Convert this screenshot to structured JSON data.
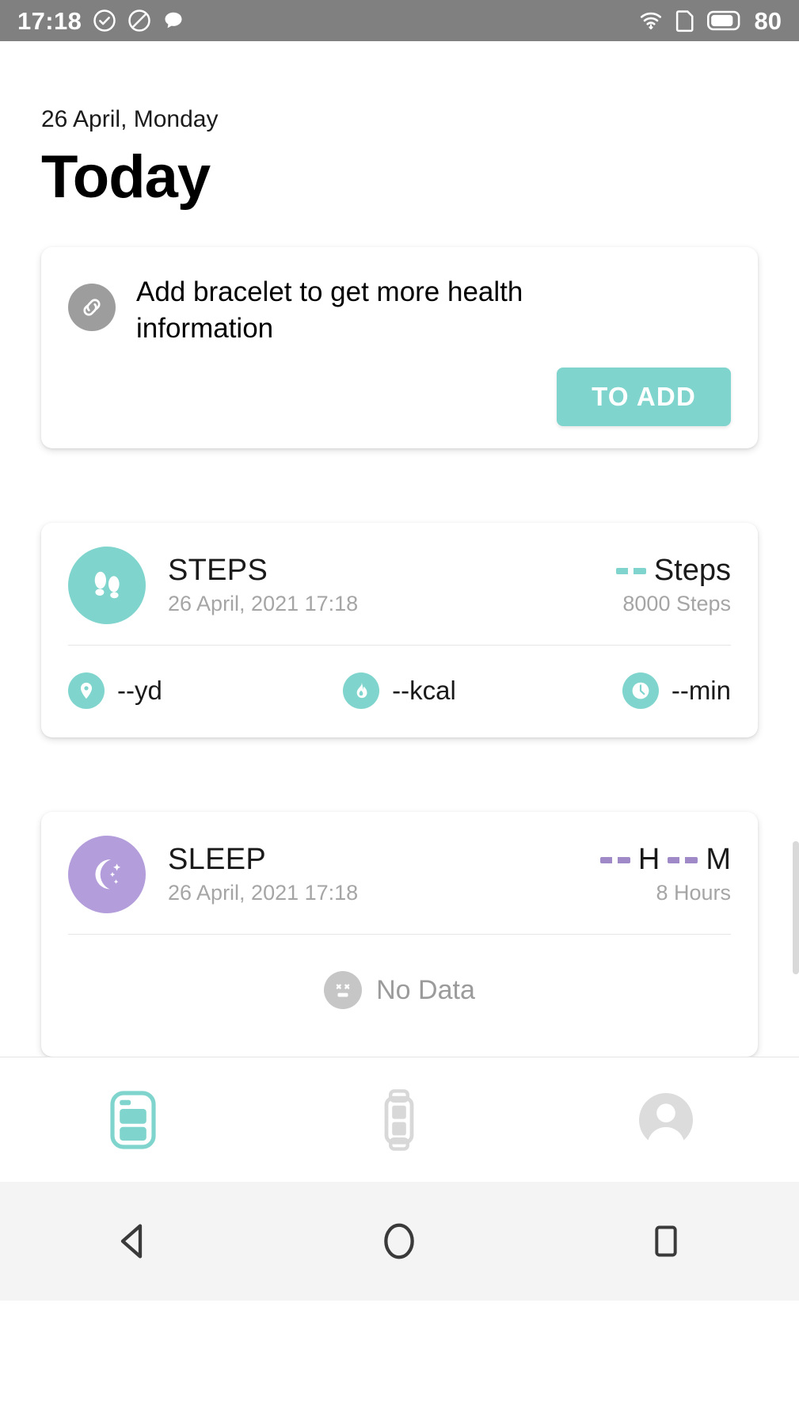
{
  "status_bar": {
    "time": "17:18",
    "battery_level": "80",
    "left_icons": [
      "check-circle-icon",
      "do-not-disturb-icon",
      "message-bubble-icon"
    ],
    "right_icons": [
      "wifi-icon",
      "sim-card-icon",
      "battery-icon"
    ],
    "background_color": "#808080"
  },
  "header": {
    "date": "26 April, Monday",
    "title": "Today"
  },
  "banner": {
    "icon": "link-icon",
    "message": "Add bracelet to get more health information",
    "button_label": "TO ADD",
    "button_color": "#7fd5cd"
  },
  "cards": [
    {
      "id": "steps",
      "icon": "footprints-icon",
      "accent_color": "#7fd5cd",
      "name": "STEPS",
      "timestamp": "26 April, 2021 17:18",
      "legend_label": "Steps",
      "legend_value": "8000 Steps",
      "stats": [
        {
          "icon": "location-pin-icon",
          "value": "--yd"
        },
        {
          "icon": "flame-icon",
          "value": "--kcal"
        },
        {
          "icon": "clock-icon",
          "value": "--min"
        }
      ]
    },
    {
      "id": "sleep",
      "icon": "moon-stars-icon",
      "accent_color": "#b39ddb",
      "name": "SLEEP",
      "timestamp": "26 April, 2021 17:18",
      "legend_hours": "H",
      "legend_minutes": "M",
      "legend_value": "8 Hours",
      "empty_state": {
        "icon": "dizzy-face-icon",
        "text": "No Data"
      }
    }
  ],
  "bottom_nav": {
    "items": [
      {
        "id": "home",
        "icon": "phone-app-icon",
        "active": true
      },
      {
        "id": "device",
        "icon": "smart-band-icon",
        "active": false
      },
      {
        "id": "profile",
        "icon": "person-icon",
        "active": false
      }
    ],
    "active_color": "#7fd5cd",
    "inactive_color": "#d8d8d8"
  },
  "system_bar": {
    "items": [
      {
        "id": "back",
        "icon": "back-triangle-icon"
      },
      {
        "id": "home",
        "icon": "home-circle-icon"
      },
      {
        "id": "recents",
        "icon": "recents-square-icon"
      }
    ]
  }
}
